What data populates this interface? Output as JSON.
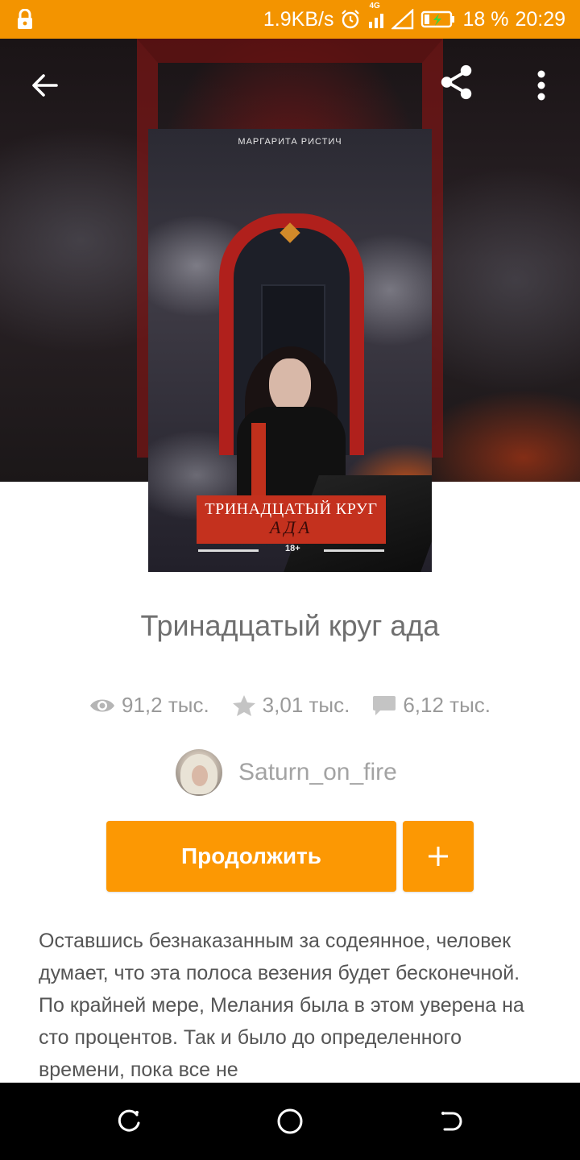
{
  "status_bar": {
    "speed": "1.9KB/s",
    "network": "4G",
    "battery": "18 %",
    "time": "20:29",
    "background_color": "#f39400"
  },
  "toolbar": {
    "back_icon": "arrow-left-icon",
    "share_icon": "share-icon",
    "more_icon": "more-vertical-icon"
  },
  "cover": {
    "author": "МАРГАРИТА  РИСТИЧ",
    "title_line1": "ТРИНАДЦАТЫЙ КРУГ",
    "title_line2": "АДА",
    "age_rating": "18+"
  },
  "book": {
    "title": "Тринадцатый круг ада",
    "stats": {
      "views": "91,2 тыс.",
      "stars": "3,01 тыс.",
      "comments": "6,12 тыс."
    },
    "author_name": "Saturn_on_fire",
    "description": "Оставшись безнаказанным за содеянное, человек думает, что эта полоса везения будет бесконечной. По крайней мере, Мелания была в этом уверена на сто процентов. Так и было до определенного времени, пока все не"
  },
  "actions": {
    "continue_label": "Продолжить",
    "add_label": "+",
    "accent_color": "#fc9803"
  },
  "system_nav": {
    "recent_icon": "recent-apps-icon",
    "home_icon": "home-circle-icon",
    "back_icon": "system-back-icon"
  }
}
